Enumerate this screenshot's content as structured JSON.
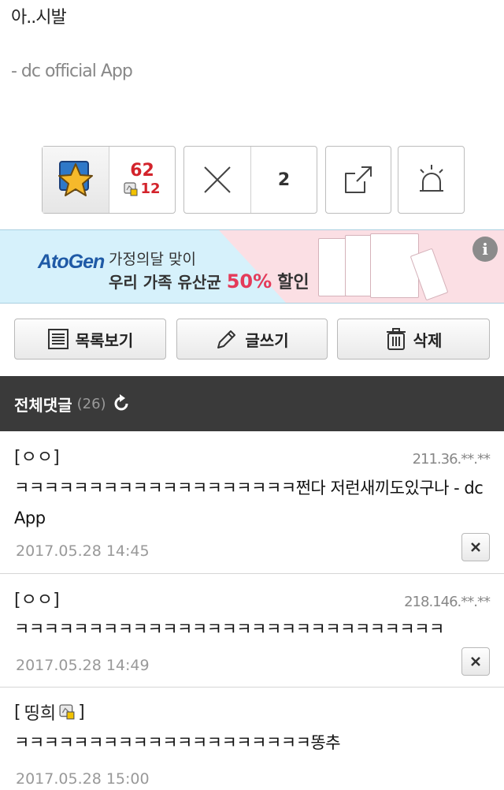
{
  "post": {
    "text": "아..시발",
    "signature": "- dc official App"
  },
  "votes": {
    "up_count": "62",
    "fix_count": "12",
    "down_count": "2"
  },
  "ad": {
    "brand": "AtoGen",
    "line1": "가정의달 맞이",
    "line2_prefix": "우리 가족 유산균",
    "line2_percent": "50%",
    "line2_suffix": "할인",
    "info_label": "i",
    "colors": {
      "left_bg": "#d6f1fb",
      "right_bg": "#fbdfe4",
      "accent": "#e43b5a"
    }
  },
  "actions": {
    "list_label": "목록보기",
    "write_label": "글쓰기",
    "delete_label": "삭제"
  },
  "comments_header": {
    "title": "전체댓글",
    "count": "(26)"
  },
  "comments": [
    {
      "author": "[ㅇㅇ]",
      "ip": "211.36.**.**",
      "text": "ㅋㅋㅋㅋㅋㅋㅋㅋㅋㅋㅋㅋㅋㅋㅋㅋㅋㅋㅋ쩐다 저런새끼도있구나 - dc App",
      "date": "2017.05.28 14:45"
    },
    {
      "author": "[ㅇㅇ]",
      "ip": "218.146.**.**",
      "text": "ㅋㅋㅋㅋㅋㅋㅋㅋㅋㅋㅋㅋㅋㅋㅋㅋㅋㅋㅋㅋㅋㅋㅋㅋㅋㅋㅋㅋㅋ",
      "date": "2017.05.28 14:49"
    },
    {
      "author_name": "띵희",
      "author_open": "[",
      "author_close": "]",
      "text": "ㅋㅋㅋㅋㅋㅋㅋㅋㅋㅋㅋㅋㅋㅋㅋㅋㅋㅋㅋㅋ똥추",
      "date": "2017.05.28 15:00"
    }
  ]
}
